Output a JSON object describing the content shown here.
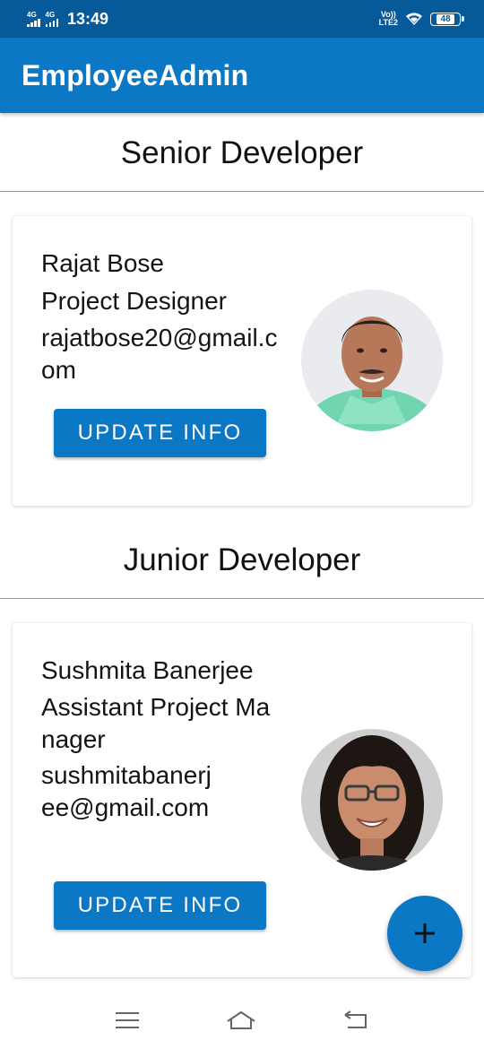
{
  "status_bar": {
    "network_1": "4G",
    "network_2": "4G",
    "time": "13:49",
    "volte_top": "Vo))",
    "volte_bottom": "LTE2",
    "battery": "48"
  },
  "app_bar": {
    "title": "EmployeeAdmin"
  },
  "sections": [
    {
      "heading": "Senior Developer",
      "employee": {
        "name": "Rajat Bose",
        "role": "Project Designer",
        "email": "rajatbose20@gmail.com",
        "button_label": "UPDATE INFO"
      }
    },
    {
      "heading": "Junior Developer",
      "employee": {
        "name": "Sushmita Banerjee",
        "role": "Assistant Project Manager",
        "email": "sushmitabanerjee@gmail.com",
        "button_label": "UPDATE INFO"
      }
    }
  ],
  "fab": {
    "icon": "plus-icon"
  },
  "nav_bar": {
    "icons": [
      "menu-icon",
      "home-icon",
      "back-icon"
    ]
  },
  "colors": {
    "status_bar": "#075a99",
    "primary": "#0a78c4",
    "divider": "#9a9a9a"
  }
}
